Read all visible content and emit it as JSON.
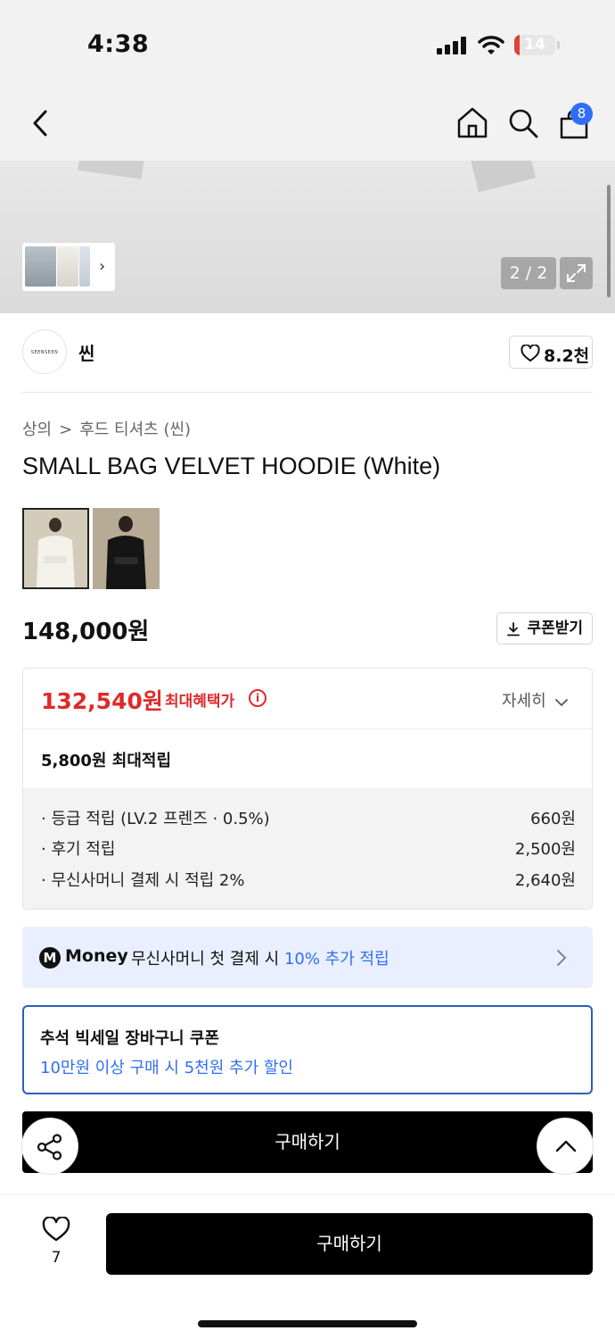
{
  "status_bar": {
    "time": "4:38",
    "battery": "14",
    "battery_level": 0.14
  },
  "nav": {
    "cart_count": "8",
    "icons": [
      "back-icon",
      "home-icon",
      "search-icon",
      "cart-icon"
    ]
  },
  "gallery": {
    "counter": "2 / 2"
  },
  "brand": {
    "logo_text": "SEENSEEN",
    "name": "씬",
    "likes": "8.2천"
  },
  "breadcrumb": {
    "category": "상의",
    "separator": ">",
    "subcategory": "후드 티셔츠 (씬)"
  },
  "product": {
    "title": "SMALL BAG VELVET HOODIE (White)",
    "price": "148,000원",
    "coupon_label": "쿠폰받기"
  },
  "benefit": {
    "sale_price": "132,540원",
    "sale_label": "최대혜택가",
    "info_icon": "i",
    "detail_label": "자세히",
    "points_summary": "5,800원 최대적립",
    "rows": [
      {
        "label": "· 등급 적립 (LV.2 프렌즈 · 0.5%)",
        "value": "660원"
      },
      {
        "label": "· 후기 적립",
        "value": "2,500원"
      },
      {
        "label": "· 무신사머니 결제 시 적립 2%",
        "value": "2,640원"
      }
    ]
  },
  "money_banner": {
    "logo": "M",
    "brand": "Money",
    "text": "무신사머니 첫 결제 시 ",
    "highlight": "10% 추가 적립"
  },
  "event": {
    "title": "추석 빅세일 장바구니 쿠폰",
    "subtitle": "10만원 이상 구매 시 5천원 추가 할인"
  },
  "inline_buy": {
    "label": "구매하기"
  },
  "bottom_bar": {
    "like_count": "7",
    "buy_label": "구매하기"
  },
  "colors": {
    "accent_red": "#e0292a",
    "accent_blue": "#2f6ff6",
    "badge_blue": "#2f6ff6"
  }
}
